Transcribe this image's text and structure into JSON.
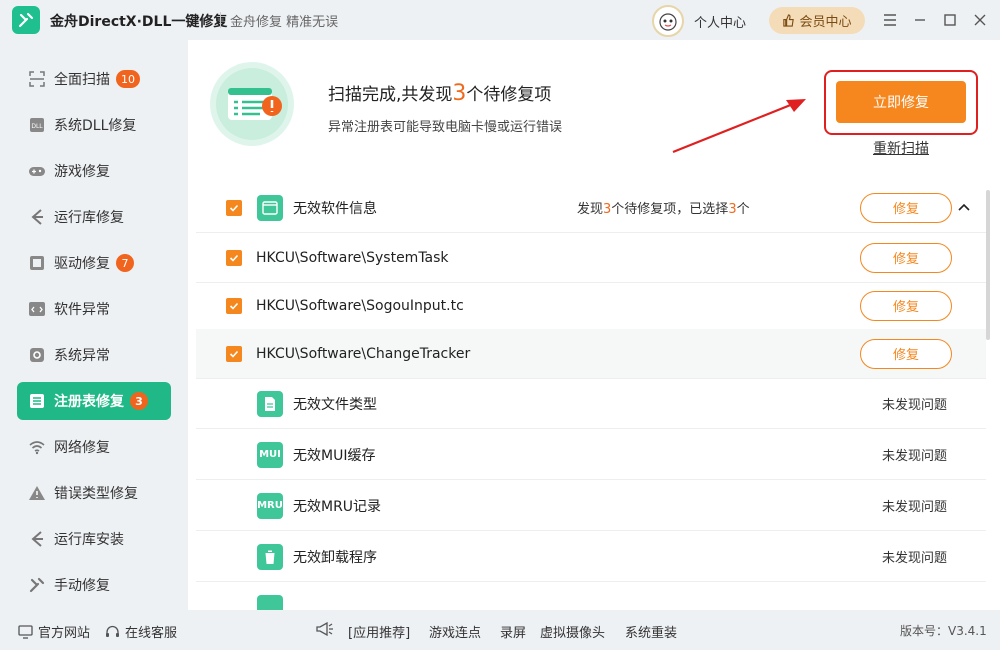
{
  "titlebar": {
    "app_title": "金舟DirectX·DLL一键修复",
    "slogan": "金舟修复 精准无误",
    "personal_center": "个人中心",
    "vip_center": "会员中心"
  },
  "sidebar": {
    "items": [
      {
        "label": "全面扫描",
        "badge": "10",
        "icon": "scan-icon"
      },
      {
        "label": "系统DLL修复",
        "badge": "",
        "icon": "dll-icon"
      },
      {
        "label": "游戏修复",
        "badge": "",
        "icon": "gamepad-icon"
      },
      {
        "label": "运行库修复",
        "badge": "",
        "icon": "runtime-icon"
      },
      {
        "label": "驱动修复",
        "badge": "7",
        "icon": "driver-icon"
      },
      {
        "label": "软件异常",
        "badge": "",
        "icon": "code-icon"
      },
      {
        "label": "系统异常",
        "badge": "",
        "icon": "gear-icon"
      },
      {
        "label": "注册表修复",
        "badge": "3",
        "icon": "registry-icon"
      },
      {
        "label": "网络修复",
        "badge": "",
        "icon": "wifi-icon"
      },
      {
        "label": "错误类型修复",
        "badge": "",
        "icon": "warning-icon"
      },
      {
        "label": "运行库安装",
        "badge": "",
        "icon": "runtime-install-icon"
      },
      {
        "label": "手动修复",
        "badge": "",
        "icon": "wrench-icon"
      }
    ]
  },
  "hero": {
    "title_prefix": "扫描完成,共发现",
    "count": "3",
    "title_suffix": "个待修复项",
    "subtitle": "异常注册表可能导致电脑卡慢或运行错误",
    "repair_now": "立即修复",
    "rescan": "重新扫描"
  },
  "group": {
    "label": "无效软件信息",
    "summary_a": "发现",
    "summary_found": "3",
    "summary_b": "个待修复项，已选择",
    "summary_selected": "3",
    "summary_c": "个",
    "fix_label": "修复"
  },
  "entries": [
    {
      "path": "HKCU\\Software\\SystemTask",
      "fix_label": "修复"
    },
    {
      "path": "HKCU\\Software\\SogouInput.tc",
      "fix_label": "修复"
    },
    {
      "path": "HKCU\\Software\\ChangeTracker",
      "fix_label": "修复"
    }
  ],
  "categories": [
    {
      "label": "无效文件类型",
      "status": "未发现问题",
      "icon": "file-icon",
      "icon_text": ""
    },
    {
      "label": "无效MUI缓存",
      "status": "未发现问题",
      "icon": "mui-icon",
      "icon_text": "MUI"
    },
    {
      "label": "无效MRU记录",
      "status": "未发现问题",
      "icon": "mru-icon",
      "icon_text": "MRU"
    },
    {
      "label": "无效卸载程序",
      "status": "未发现问题",
      "icon": "trash-icon",
      "icon_text": ""
    }
  ],
  "footer": {
    "official_site": "官方网站",
    "online_service": "在线客服",
    "recommend": "[应用推荐]",
    "links": [
      "游戏连点",
      "录屏",
      "虚拟摄像头",
      "系统重装"
    ],
    "version": "版本号：V3.4.1"
  },
  "colors": {
    "accent_green": "#20b886",
    "accent_orange": "#f5871f",
    "badge": "#f0641e",
    "highlight_red": "#e02020"
  }
}
